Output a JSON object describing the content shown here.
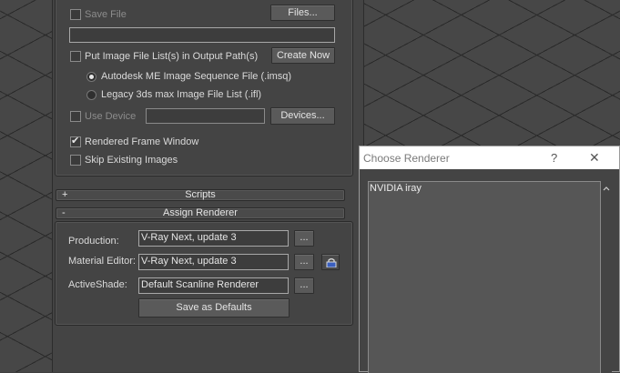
{
  "output": {
    "save_file_label": "Save File",
    "files_button": "Files...",
    "put_image_list_label": "Put Image File List(s) in Output Path(s)",
    "create_now_button": "Create Now",
    "radio_imsq_label": "Autodesk ME Image Sequence File (.imsq)",
    "radio_ifl_label": "Legacy 3ds max Image File List (.ifl)",
    "use_device_label": "Use Device",
    "devices_button": "Devices...",
    "rendered_frame_window_label": "Rendered Frame Window",
    "skip_existing_label": "Skip Existing Images"
  },
  "rollouts": {
    "scripts": {
      "sign": "+",
      "label": "Scripts"
    },
    "assign_renderer": {
      "sign": "-",
      "label": "Assign Renderer"
    }
  },
  "assign": {
    "production_label": "Production:",
    "production_value": "V-Ray Next, update 3",
    "material_editor_label": "Material Editor:",
    "material_editor_value": "V-Ray Next, update 3",
    "activeshade_label": "ActiveShade:",
    "activeshade_value": "Default Scanline Renderer",
    "browse_label": "...",
    "save_defaults_button": "Save as Defaults"
  },
  "dialog": {
    "title": "Choose Renderer",
    "help": "?",
    "close": "✕",
    "items": [
      "NVIDIA iray"
    ]
  },
  "icons": {
    "lock": "lock-icon",
    "scroll_up": "chevron-up-icon"
  }
}
